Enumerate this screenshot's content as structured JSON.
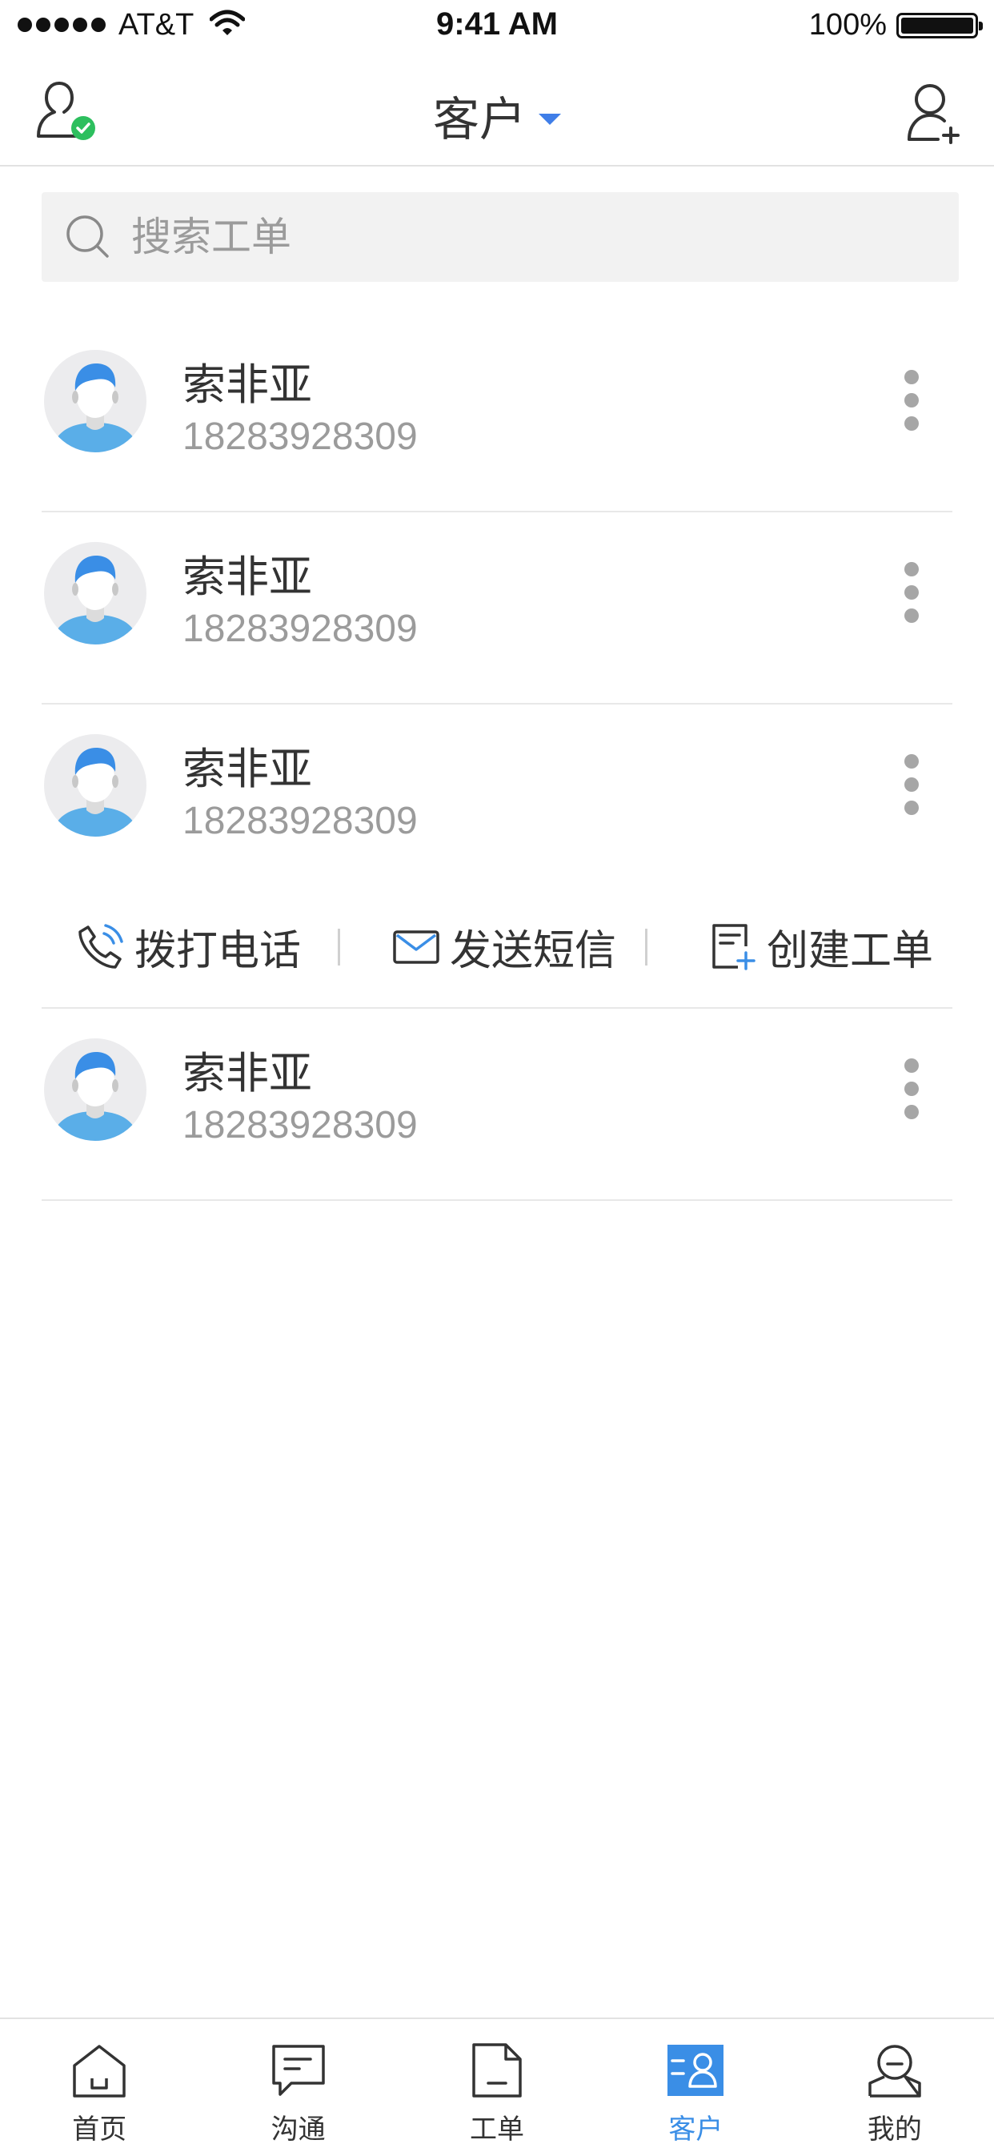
{
  "status_bar": {
    "carrier": "AT&T",
    "time": "9:41 AM",
    "battery": "100%"
  },
  "nav": {
    "title": "客户",
    "left_icon": "user-verified-icon",
    "right_icon": "add-user-icon"
  },
  "search": {
    "placeholder": "搜索工单",
    "value": ""
  },
  "customers": [
    {
      "name": "索非亚",
      "phone": "18283928309"
    },
    {
      "name": "索非亚",
      "phone": "18283928309"
    },
    {
      "name": "索非亚",
      "phone": "18283928309"
    },
    {
      "name": "索非亚",
      "phone": "18283928309"
    }
  ],
  "actions": {
    "call": "拨打电话",
    "sms": "发送短信",
    "create_order": "创建工单"
  },
  "tabs": [
    {
      "label": "首页",
      "icon": "home-icon"
    },
    {
      "label": "沟通",
      "icon": "chat-icon"
    },
    {
      "label": "工单",
      "icon": "document-icon"
    },
    {
      "label": "客户",
      "icon": "customer-icon"
    },
    {
      "label": "我的",
      "icon": "profile-icon"
    }
  ],
  "active_tab": "客户",
  "colors": {
    "accent": "#3a8ee6",
    "verified": "#2dbf5e",
    "avatar_hair": "#3a8ee6",
    "avatar_shirt": "#5aaee8"
  }
}
